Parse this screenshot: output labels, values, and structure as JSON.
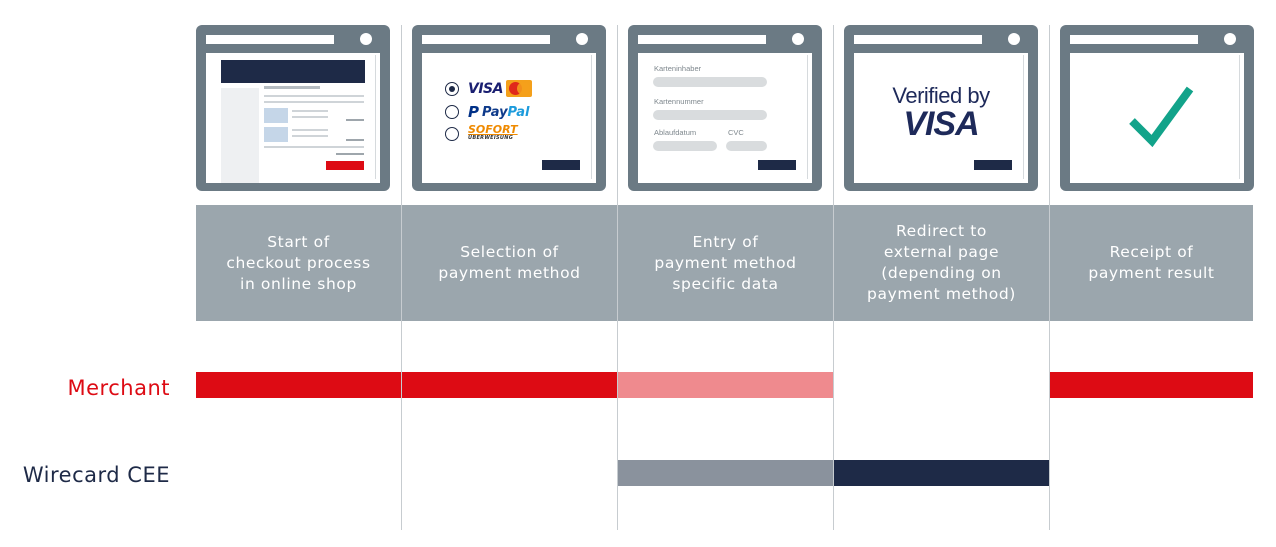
{
  "screens": {
    "payment": {
      "visa": "VISA",
      "mastercard": "MasterCard",
      "paypal_a": "Pay",
      "paypal_b": "Pal",
      "sofort": "SOFORT",
      "sofort_sub": "ÜBERWEISUNG"
    },
    "form": {
      "card_holder": "Karteninhaber",
      "card_number": "Kartennummer",
      "expiry": "Ablaufdatum",
      "cvc": "CVC"
    },
    "verified": {
      "line1": "Verified by",
      "line2": "VISA"
    }
  },
  "steps": [
    {
      "label": "Start of\ncheckout process\nin online shop"
    },
    {
      "label": "Selection of\npayment method"
    },
    {
      "label": "Entry of\npayment method\nspecific data"
    },
    {
      "label": "Redirect to\nexternal page\n(depending on\npayment method)"
    },
    {
      "label": "Receipt of\npayment result"
    }
  ],
  "rows": {
    "merchant": "Merchant",
    "wirecard": "Wirecard CEE"
  },
  "colors": {
    "merchant_red": "#dd0b14",
    "merchant_light": "#ef8a8e",
    "wirecard_gray": "#8a929d",
    "wirecard_navy": "#1e2a47",
    "step_bg": "#9ba6ad",
    "window_frame": "#6b7a84"
  },
  "icons": [
    "browser-window-icon",
    "checkmark-icon",
    "visa-logo",
    "mastercard-logo",
    "paypal-logo",
    "sofort-logo"
  ]
}
